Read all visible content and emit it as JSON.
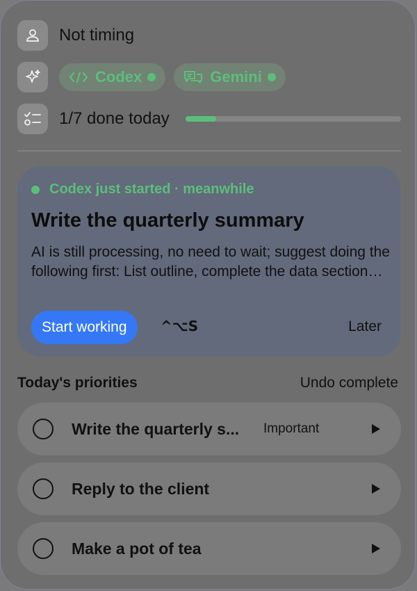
{
  "timer": {
    "status": "Not timing",
    "icon": "person-icon"
  },
  "agents": {
    "icon": "sparkle-icon",
    "items": [
      {
        "label": "Codex",
        "icon": "code-icon",
        "status_color": "#5bbf7a"
      },
      {
        "label": "Gemini",
        "icon": "chat-bubbles-icon",
        "status_color": "#5bbf7a"
      }
    ]
  },
  "progress": {
    "icon": "checklist-icon",
    "label": "1/7 done today",
    "done": 1,
    "total": 7
  },
  "suggestion": {
    "status": "Codex just started · meanwhile",
    "title": "Write the quarterly summary",
    "description": "AI is still processing, no need to wait; suggest doing the following first: List outline, complete the data section and review the key figures",
    "start_label": "Start working",
    "shortcut": "^⌥S",
    "later_label": "Later"
  },
  "priorities": {
    "title": "Today's priorities",
    "undo_label": "Undo complete",
    "tasks": [
      {
        "label": "Write the quarterly s...",
        "tag": "Important"
      },
      {
        "label": "Reply to the client",
        "tag": ""
      },
      {
        "label": "Make a pot of tea",
        "tag": ""
      }
    ]
  },
  "colors": {
    "accent_green": "#5bbf7a",
    "accent_blue": "#3478f6",
    "panel": "#6e6e6e",
    "card": "#636a7c"
  }
}
